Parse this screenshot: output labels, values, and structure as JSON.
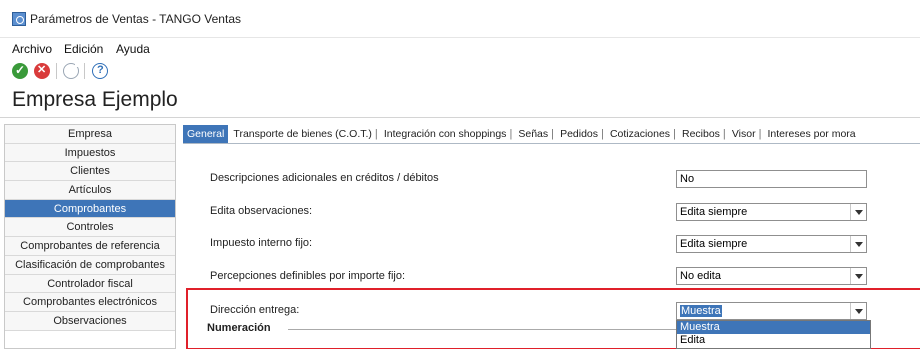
{
  "window": {
    "title": "Parámetros de Ventas - TANGO Ventas"
  },
  "menu": {
    "archivo": "Archivo",
    "edicion": "Edición",
    "ayuda": "Ayuda"
  },
  "toolbar": {
    "icons": [
      "ok-icon",
      "cancel-icon",
      "refresh-icon",
      "help-icon"
    ]
  },
  "company": "Empresa Ejemplo",
  "sidebar": {
    "selected_index": 4,
    "items": [
      {
        "label": "Empresa"
      },
      {
        "label": "Impuestos"
      },
      {
        "label": "Clientes"
      },
      {
        "label": "Artículos"
      },
      {
        "label": "Comprobantes"
      },
      {
        "label": "Controles"
      },
      {
        "label": "Comprobantes de referencia"
      },
      {
        "label": "Clasificación de comprobantes"
      },
      {
        "label": "Controlador fiscal"
      },
      {
        "label": "Comprobantes electrónicos"
      },
      {
        "label": "Observaciones"
      }
    ]
  },
  "tabs": [
    {
      "label": "General",
      "active": true
    },
    {
      "label": "Transporte de bienes (C.O.T.)"
    },
    {
      "label": "Integración con shoppings"
    },
    {
      "label": "Señas"
    },
    {
      "label": "Pedidos"
    },
    {
      "label": "Cotizaciones"
    },
    {
      "label": "Recibos"
    },
    {
      "label": "Visor"
    },
    {
      "label": "Intereses por mora"
    }
  ],
  "form": {
    "desc_adicionales": {
      "label": "Descripciones adicionales en créditos / débitos",
      "value": "No"
    },
    "edita_obs": {
      "label": "Edita observaciones:",
      "value": "Edita siempre"
    },
    "impuesto_interno": {
      "label": "Impuesto interno fijo:",
      "value": "Edita siempre"
    },
    "percepciones": {
      "label": "Percepciones definibles por importe fijo:",
      "value": "No edita"
    },
    "direccion": {
      "label": "Dirección entrega:",
      "value": "Muestra"
    }
  },
  "section": {
    "numeracion": "Numeración"
  },
  "dropdown": {
    "options": [
      "Muestra",
      "Edita"
    ],
    "highlighted_index": 0
  },
  "colors": {
    "accent": "#3e75b8",
    "highlight_border": "#e0202a"
  }
}
